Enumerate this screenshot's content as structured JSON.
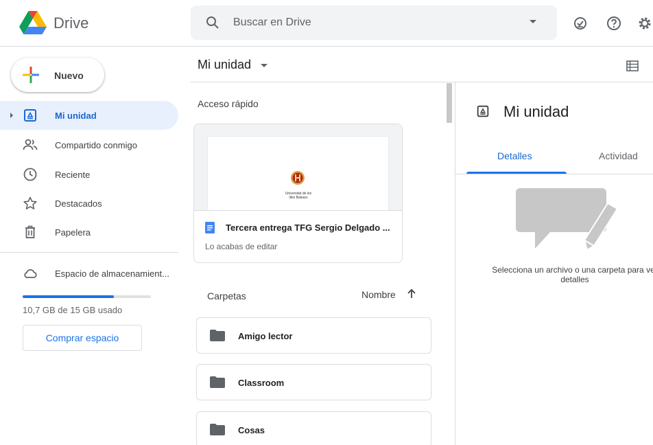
{
  "header": {
    "app_name": "Drive",
    "search_placeholder": "Buscar en Drive",
    "icons": [
      "search-icon",
      "search-options-icon",
      "offline-check-icon",
      "help-icon",
      "settings-icon"
    ]
  },
  "sidebar": {
    "new_button_label": "Nuevo",
    "items": [
      {
        "label": "Mi unidad",
        "icon": "my-drive-icon",
        "active": true
      },
      {
        "label": "Compartido conmigo",
        "icon": "shared-icon"
      },
      {
        "label": "Reciente",
        "icon": "clock-icon"
      },
      {
        "label": "Destacados",
        "icon": "star-icon"
      },
      {
        "label": "Papelera",
        "icon": "trash-icon"
      }
    ],
    "storage": {
      "label": "Espacio de almacenamient...",
      "icon": "cloud-icon",
      "used_text": "10,7 GB de 15 GB usado",
      "used_fraction": 0.713,
      "buy_label": "Comprar espacio"
    }
  },
  "main": {
    "title": "Mi unidad",
    "quick_access_label": "Acceso rápido",
    "quick_access": [
      {
        "name": "Tercera entrega TFG Sergio Delgado ...",
        "subtitle": "Lo acabas de editar",
        "thumbnail_caption": "Universitat de les\nIlles Balears"
      }
    ],
    "folders_label": "Carpetas",
    "sort_label": "Nombre",
    "sort_direction": "ascending",
    "folders": [
      {
        "name": "Amigo lector"
      },
      {
        "name": "Classroom"
      },
      {
        "name": "Cosas"
      }
    ]
  },
  "details": {
    "title": "Mi unidad",
    "tabs": [
      {
        "label": "Detalles",
        "active": true
      },
      {
        "label": "Actividad"
      }
    ],
    "empty_message": "Selecciona un archivo o una carpeta para ver\ndetalles"
  },
  "colors": {
    "accent": "#1a73e8",
    "active_bg": "#e8f0fe",
    "active_text": "#1967d2"
  }
}
